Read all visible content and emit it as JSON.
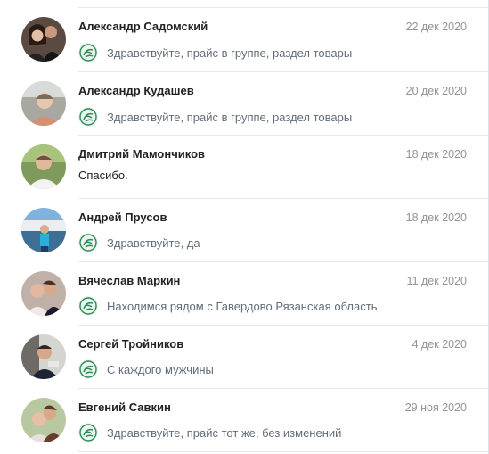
{
  "dialogs": [
    {
      "name": "Александр Садомский",
      "date": "22 дек 2020",
      "message": "Здравствуйте, прайс в группе, раздел товары",
      "outgoing": true
    },
    {
      "name": "Александр Кудашев",
      "date": "20 дек 2020",
      "message": "Здравствуйте, прайс в группе, раздел товары",
      "outgoing": true
    },
    {
      "name": "Дмитрий Мамончиков",
      "date": "18 дек 2020",
      "message": "Спасибо.",
      "outgoing": false
    },
    {
      "name": "Андрей Прусов",
      "date": "18 дек 2020",
      "message": "Здравствуйте, да",
      "outgoing": true
    },
    {
      "name": "Вячеслав Маркин",
      "date": "11 дек 2020",
      "message": "Находимся рядом с Гавердово Рязанская область",
      "outgoing": true
    },
    {
      "name": "Сергей Тройников",
      "date": "4 дек 2020",
      "message": "С каждого мужчины",
      "outgoing": true
    },
    {
      "name": "Евгений Савкин",
      "date": "29 ноя 2020",
      "message": "Здравствуйте, прайс тот же, без изменений",
      "outgoing": true
    }
  ],
  "colors": {
    "name": "#222222",
    "date": "#939393",
    "message_outgoing": "#626d7a",
    "divider": "#e7e8ec",
    "own_avatar": "#2e8b57"
  },
  "icons": {
    "own_avatar": "money-logo-icon"
  }
}
